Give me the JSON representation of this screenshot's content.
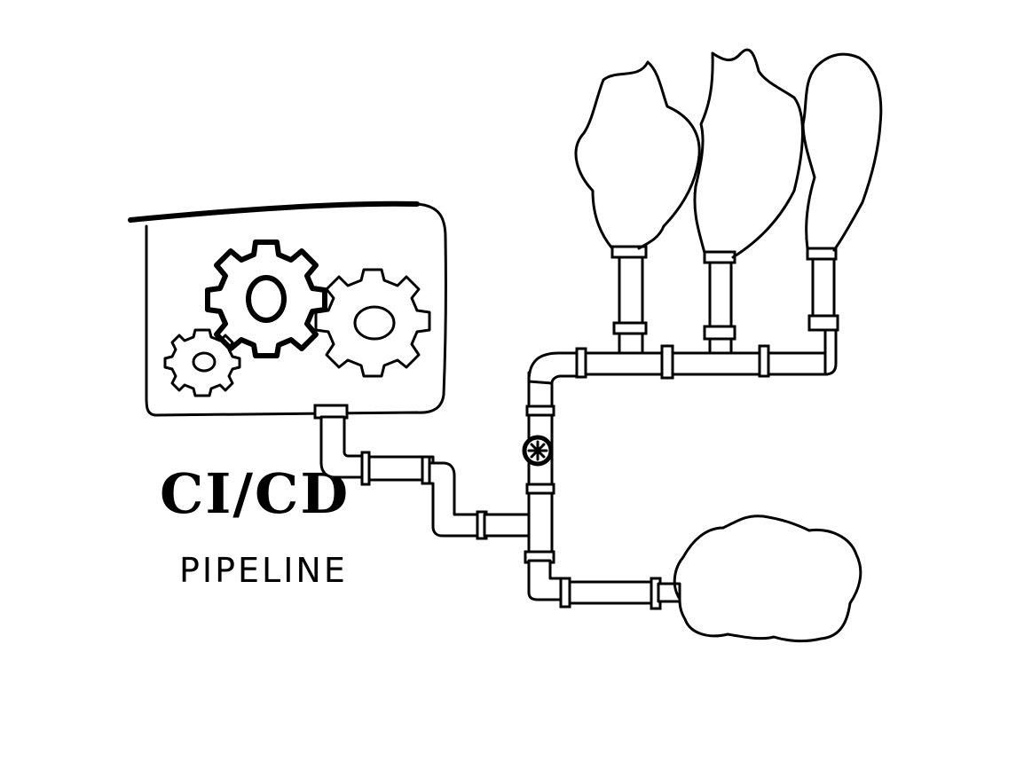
{
  "title": "CI/CD",
  "subtitle": "PIPELINE",
  "colors": {
    "ink": "#000000",
    "background": "#ffffff"
  },
  "icons": [
    "gear-icon",
    "valve-icon",
    "smoke-cloud-icon",
    "cloud-icon"
  ]
}
